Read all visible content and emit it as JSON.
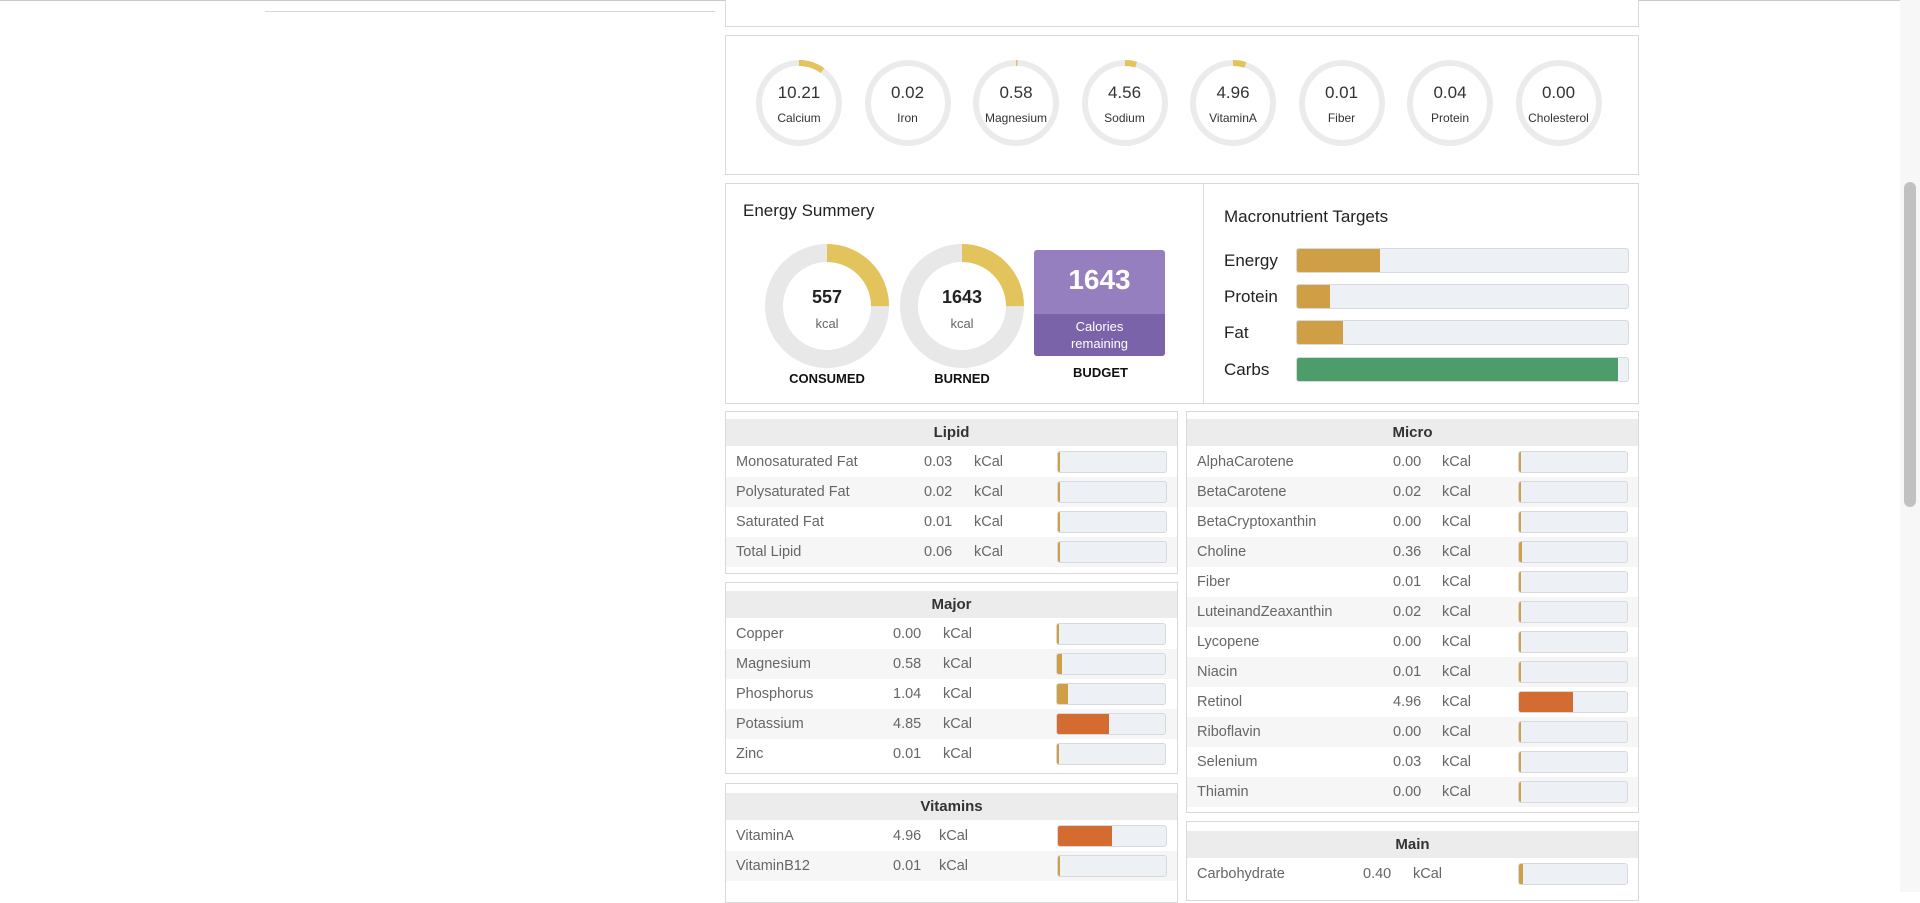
{
  "colors": {
    "gold": "#cf9f45",
    "orange": "#d46c32",
    "green": "#4d9d6b",
    "ring": "#e3c35b",
    "budget": "#957fbf"
  },
  "nutrient_rings": [
    {
      "value": "10.21",
      "label": "Calcium",
      "fraction": 0.1
    },
    {
      "value": "0.02",
      "label": "Iron",
      "fraction": 0.0
    },
    {
      "value": "0.58",
      "label": "Magnesium",
      "fraction": 0.006
    },
    {
      "value": "4.56",
      "label": "Sodium",
      "fraction": 0.045
    },
    {
      "value": "4.96",
      "label": "VitaminA",
      "fraction": 0.05
    },
    {
      "value": "0.01",
      "label": "Fiber",
      "fraction": 0.0
    },
    {
      "value": "0.04",
      "label": "Protein",
      "fraction": 0.0
    },
    {
      "value": "0.00",
      "label": "Cholesterol",
      "fraction": 0.0
    }
  ],
  "energy": {
    "title": "Energy Summery",
    "consumed": {
      "value": "557",
      "unit": "kcal",
      "caption": "CONSUMED",
      "fraction": 0.25
    },
    "burned": {
      "value": "1643",
      "unit": "kcal",
      "caption": "BURNED",
      "fraction": 0.25
    },
    "budget": {
      "value": "1643",
      "line1": "Calories",
      "line2": "remaining",
      "caption": "BUDGET"
    }
  },
  "macros": {
    "title": "Macronutrient Targets",
    "items": [
      {
        "label": "Energy",
        "percent": 25,
        "color": "gold"
      },
      {
        "label": "Protein",
        "percent": 10,
        "color": "gold"
      },
      {
        "label": "Fat",
        "percent": 14,
        "color": "gold"
      },
      {
        "label": "Carbs",
        "percent": 97,
        "color": "green"
      }
    ]
  },
  "lipid": {
    "title": "Lipid",
    "rows": [
      {
        "name": "Monosaturated Fat",
        "value": "0.03",
        "unit": "kCal",
        "percent": 1,
        "color": "gold"
      },
      {
        "name": "Polysaturated Fat",
        "value": "0.02",
        "unit": "kCal",
        "percent": 1,
        "color": "gold"
      },
      {
        "name": "Saturated Fat",
        "value": "0.01",
        "unit": "kCal",
        "percent": 0,
        "color": "gold"
      },
      {
        "name": "Total Lipid",
        "value": "0.06",
        "unit": "kCal",
        "percent": 1,
        "color": "gold"
      }
    ]
  },
  "major": {
    "title": "Major",
    "rows": [
      {
        "name": "Copper",
        "value": "0.00",
        "unit": "kCal",
        "percent": 0,
        "color": "gold"
      },
      {
        "name": "Magnesium",
        "value": "0.58",
        "unit": "kCal",
        "percent": 5,
        "color": "gold"
      },
      {
        "name": "Phosphorus",
        "value": "1.04",
        "unit": "kCal",
        "percent": 10,
        "color": "gold"
      },
      {
        "name": "Potassium",
        "value": "4.85",
        "unit": "kCal",
        "percent": 48,
        "color": "orange"
      },
      {
        "name": "Zinc",
        "value": "0.01",
        "unit": "kCal",
        "percent": 1,
        "color": "gold"
      }
    ]
  },
  "vitamins": {
    "title": "Vitamins",
    "rows": [
      {
        "name": "VitaminA",
        "value": "4.96",
        "unit": "kCal",
        "percent": 50,
        "color": "orange"
      },
      {
        "name": "VitaminB12",
        "value": "0.01",
        "unit": "kCal",
        "percent": 1,
        "color": "gold"
      }
    ]
  },
  "micro": {
    "title": "Micro",
    "rows": [
      {
        "name": "AlphaCarotene",
        "value": "0.00",
        "unit": "kCal",
        "percent": 0,
        "color": "gold"
      },
      {
        "name": "BetaCarotene",
        "value": "0.02",
        "unit": "kCal",
        "percent": 1,
        "color": "gold"
      },
      {
        "name": "BetaCryptoxanthin",
        "value": "0.00",
        "unit": "kCal",
        "percent": 0,
        "color": "gold"
      },
      {
        "name": "Choline",
        "value": "0.36",
        "unit": "kCal",
        "percent": 3,
        "color": "gold"
      },
      {
        "name": "Fiber",
        "value": "0.01",
        "unit": "kCal",
        "percent": 1,
        "color": "gold"
      },
      {
        "name": "LuteinandZeaxanthin",
        "value": "0.02",
        "unit": "kCal",
        "percent": 1,
        "color": "gold"
      },
      {
        "name": "Lycopene",
        "value": "0.00",
        "unit": "kCal",
        "percent": 0,
        "color": "gold"
      },
      {
        "name": "Niacin",
        "value": "0.01",
        "unit": "kCal",
        "percent": 1,
        "color": "gold"
      },
      {
        "name": "Retinol",
        "value": "4.96",
        "unit": "kCal",
        "percent": 50,
        "color": "orange"
      },
      {
        "name": "Riboflavin",
        "value": "0.00",
        "unit": "kCal",
        "percent": 0,
        "color": "gold"
      },
      {
        "name": "Selenium",
        "value": "0.03",
        "unit": "kCal",
        "percent": 1,
        "color": "gold"
      },
      {
        "name": "Thiamin",
        "value": "0.00",
        "unit": "kCal",
        "percent": 0,
        "color": "gold"
      }
    ]
  },
  "main": {
    "title": "Main",
    "rows": [
      {
        "name": "Carbohydrate",
        "value": "0.40",
        "unit": "kCal",
        "percent": 4,
        "color": "gold"
      }
    ]
  }
}
